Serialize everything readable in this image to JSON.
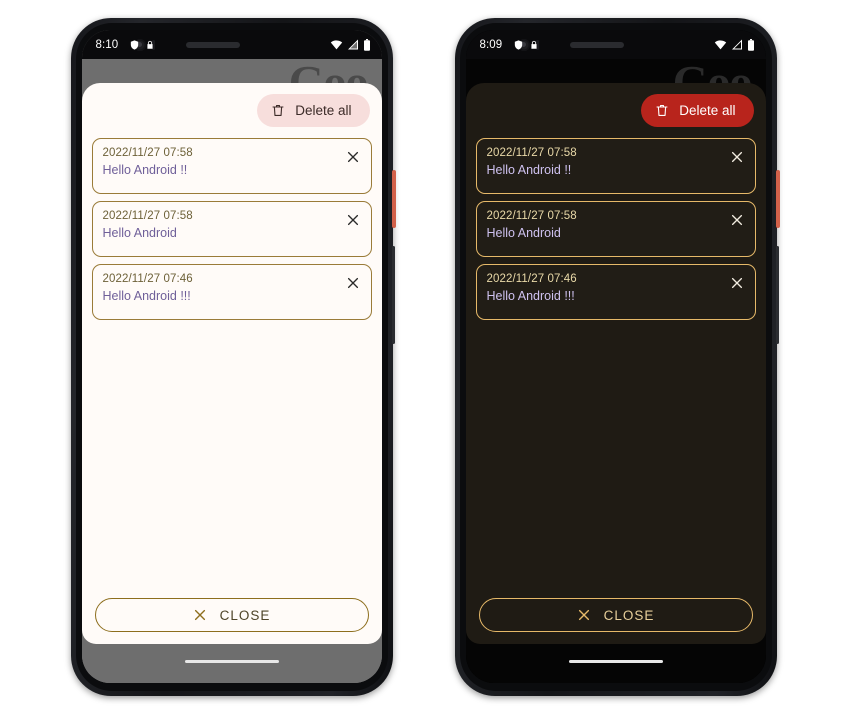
{
  "phones": [
    {
      "theme": "light",
      "name": "light-theme-phone",
      "status_bar": {
        "clock": "8:10",
        "icons_left": [
          "shield-icon",
          "lock-icon"
        ],
        "icons_right": [
          "wifi-icon",
          "cellular-signal-icon",
          "battery-icon"
        ]
      },
      "backdrop_ghost_text": "Goo",
      "dialog": {
        "delete_all_label": "Delete all",
        "delete_all_icon": "trash-icon",
        "close_label": "CLOSE",
        "close_icon": "close-x-icon",
        "items": [
          {
            "time": "2022/11/27 07:58",
            "message": "Hello Android !!",
            "dismiss_icon": "close-x-icon"
          },
          {
            "time": "2022/11/27 07:58",
            "message": "Hello Android",
            "dismiss_icon": "close-x-icon"
          },
          {
            "time": "2022/11/27 07:46",
            "message": "Hello Android !!!",
            "dismiss_icon": "close-x-icon"
          }
        ]
      },
      "colors": {
        "sheet_bg": "#FFFBF8",
        "delete_all_bg": "#F7DEDC",
        "delete_all_fg": "#3C2B28",
        "card_border": "#9A7B38",
        "time_fg": "#6D6138",
        "message_fg": "#6F5F99",
        "close_border": "#8D6E1D",
        "close_fg": "#4E4428",
        "system_bg": "#6E6E6E"
      }
    },
    {
      "theme": "dark",
      "name": "dark-theme-phone",
      "status_bar": {
        "clock": "8:09",
        "icons_left": [
          "shield-icon",
          "lock-icon"
        ],
        "icons_right": [
          "wifi-icon",
          "cellular-signal-icon",
          "battery-icon"
        ]
      },
      "backdrop_ghost_text": "Goo",
      "dialog": {
        "delete_all_label": "Delete all",
        "delete_all_icon": "trash-icon",
        "close_label": "CLOSE",
        "close_icon": "close-x-icon",
        "items": [
          {
            "time": "2022/11/27 07:58",
            "message": "Hello Android !!",
            "dismiss_icon": "close-x-icon"
          },
          {
            "time": "2022/11/27 07:58",
            "message": "Hello Android",
            "dismiss_icon": "close-x-icon"
          },
          {
            "time": "2022/11/27 07:46",
            "message": "Hello Android !!!",
            "dismiss_icon": "close-x-icon"
          }
        ]
      },
      "colors": {
        "sheet_bg": "#1F1B14",
        "delete_all_bg": "#B8241C",
        "delete_all_fg": "#FFFFFF",
        "card_border": "#E6B969",
        "time_fg": "#E9D9A8",
        "message_fg": "#CFC2F0",
        "close_border": "#E6B969",
        "close_fg": "#E7CF9A",
        "system_bg": "#050505"
      }
    }
  ]
}
